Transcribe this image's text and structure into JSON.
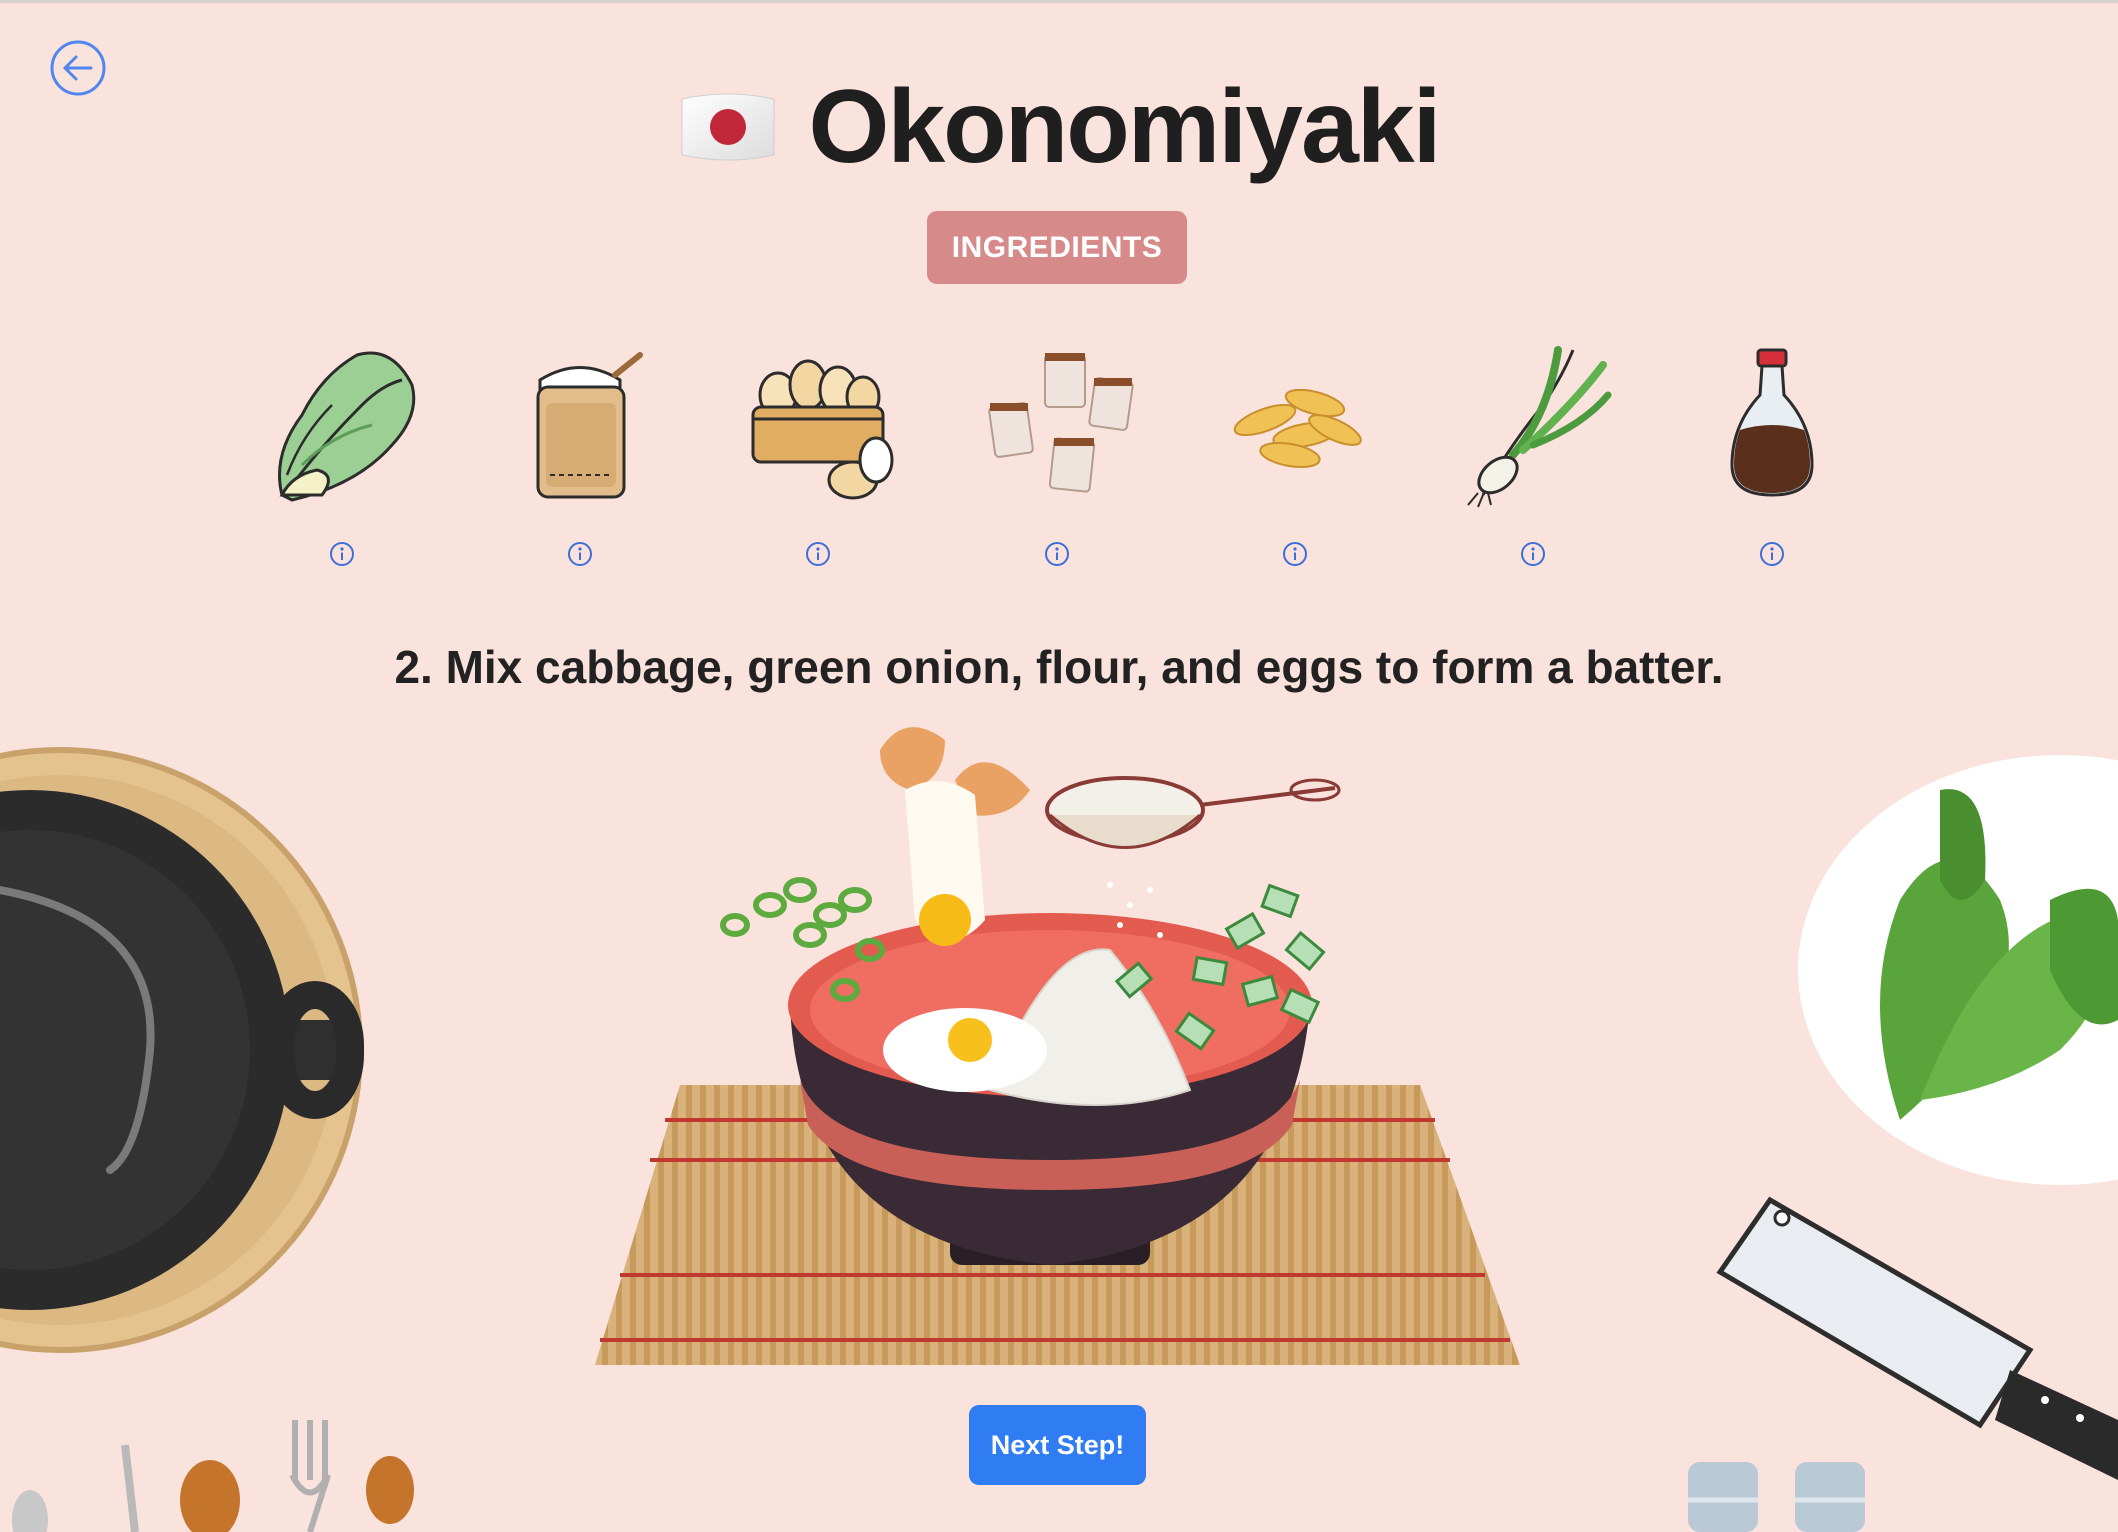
{
  "header": {
    "flag": "🇯🇵",
    "title": "Okonomiyaki",
    "back_icon": "arrow-left-circle-icon"
  },
  "ingredients_button": {
    "label": "INGREDIENTS"
  },
  "ingredients": [
    {
      "name": "cabbage",
      "icon": "cabbage-icon"
    },
    {
      "name": "flour",
      "icon": "flour-sack-icon"
    },
    {
      "name": "eggs",
      "icon": "eggs-icon"
    },
    {
      "name": "bonito flakes",
      "icon": "bonito-packets-icon"
    },
    {
      "name": "tenkasu",
      "icon": "tempura-bits-icon"
    },
    {
      "name": "green onion",
      "icon": "green-onion-icon"
    },
    {
      "name": "soy sauce",
      "icon": "soy-sauce-icon"
    }
  ],
  "step": {
    "text": "2. Mix cabbage, green onion, flour, and eggs to form a batter."
  },
  "next_button": {
    "label": "Next Step!"
  },
  "colors": {
    "background": "#fae2dd",
    "accent_blue": "#2f7cf3",
    "ingredients_button": "#d68a8a",
    "bowl_red": "#e35b4f"
  }
}
